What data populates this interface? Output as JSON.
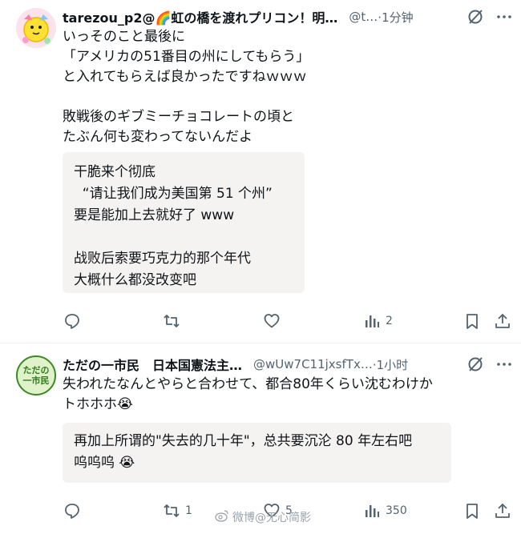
{
  "posts": [
    {
      "display_name": "tarezou_p2@🌈虹の橋を渡れプリコン！明…",
      "handle": "@t…",
      "time": "·1分钟",
      "body": [
        "いっそのこと最後に",
        "「アメリカの51番目の州にしてもらう」",
        "と入れてもらえば良かったですねｗｗｗ",
        "",
        "敗戦後のギブミーチョコレートの頃と",
        "たぶん何も変わってないんだよ"
      ],
      "translation": [
        "干脆来个彻底",
        "  “请让我们成为美国第 51 个州”",
        "要是能加上去就好了 www",
        "",
        "战败后索要巧克力的那个年代",
        "大概什么都没改变吧"
      ],
      "actions": {
        "reply": "",
        "repost": "",
        "like": "",
        "views": "2"
      }
    },
    {
      "display_name": "ただの一市民　日本国憲法主…",
      "handle": "@wUw7C11jxsfTx…",
      "time": "·1小时",
      "avatar_text": "ただの\n一市民",
      "body": [
        "失われたなんとやらと合わせて、都合80年くらい沈むわけか",
        "トホホホ😭"
      ],
      "translation": [
        "再加上所谓的\"失去的几十年\"，总共要沉沦 80 年左右吧",
        "呜呜呜 😭"
      ],
      "actions": {
        "reply": "",
        "repost": "1",
        "like": "5",
        "views": "350"
      }
    }
  ],
  "watermark": "微博@无心简影",
  "colors": {
    "secondary": "#536471",
    "translation_bg": "#f5f3f2",
    "avatar2_bg": "#dff2c9",
    "avatar2_text": "#2f7a1a"
  }
}
